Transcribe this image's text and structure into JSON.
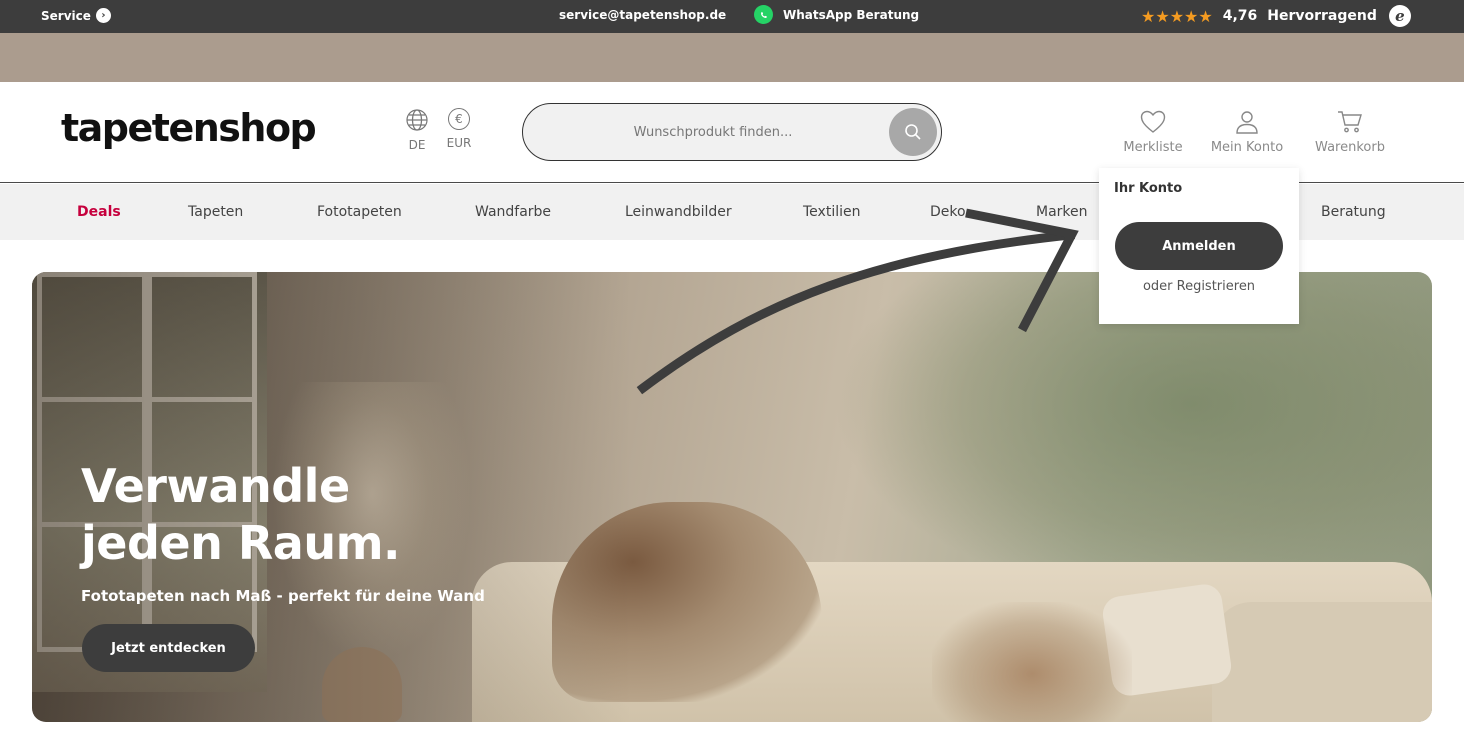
{
  "topbar": {
    "service_label": "Service",
    "email": "service@tapetenshop.de",
    "whatsapp_label": "WhatsApp Beratung",
    "rating_stars": "★★★★★",
    "rating_score": "4,76",
    "rating_text": "Hervorragend",
    "trusted_badge": "e"
  },
  "header": {
    "logo": "tapetenshop",
    "language": "DE",
    "currency_symbol": "€",
    "currency": "EUR",
    "search_placeholder": "Wunschprodukt finden...",
    "wishlist_label": "Merkliste",
    "account_label": "Mein Konto",
    "cart_label": "Warenkorb"
  },
  "nav": {
    "items": [
      "Deals",
      "Tapeten",
      "Fototapeten",
      "Wandfarbe",
      "Leinwandbilder",
      "Textilien",
      "Deko",
      "Marken",
      "Beratung"
    ]
  },
  "account_dropdown": {
    "title": "Ihr Konto",
    "login_label": "Anmelden",
    "register_label": "oder Registrieren"
  },
  "hero": {
    "headline_line1": "Verwandle",
    "headline_line2": "jeden Raum.",
    "subtitle": "Fototapeten nach Maß - perfekt für deine Wand",
    "cta_label": "Jetzt entdecken"
  },
  "colors": {
    "topbar_bg": "#3d3d3d",
    "promo_bg": "#ab9c8e",
    "deals_accent": "#c6003d",
    "star": "#f49b21",
    "whatsapp": "#25d366",
    "button_dark": "#3d3d3d"
  }
}
